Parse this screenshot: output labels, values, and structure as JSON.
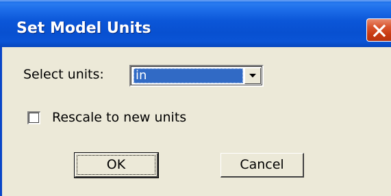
{
  "window": {
    "title": "Set Model Units"
  },
  "icons": {
    "close": "close-icon",
    "dropdown": "chevron-down-icon"
  },
  "colors": {
    "titlebar": "#0A54D6",
    "close_button": "#C83A12",
    "dialog_background": "#ECE9D8",
    "selection": "#316AC5"
  },
  "form": {
    "units_label": "Select units:",
    "units_value": "in",
    "rescale_label": "Rescale to new units",
    "rescale_checked": false
  },
  "buttons": {
    "ok_label": "OK",
    "cancel_label": "Cancel"
  }
}
